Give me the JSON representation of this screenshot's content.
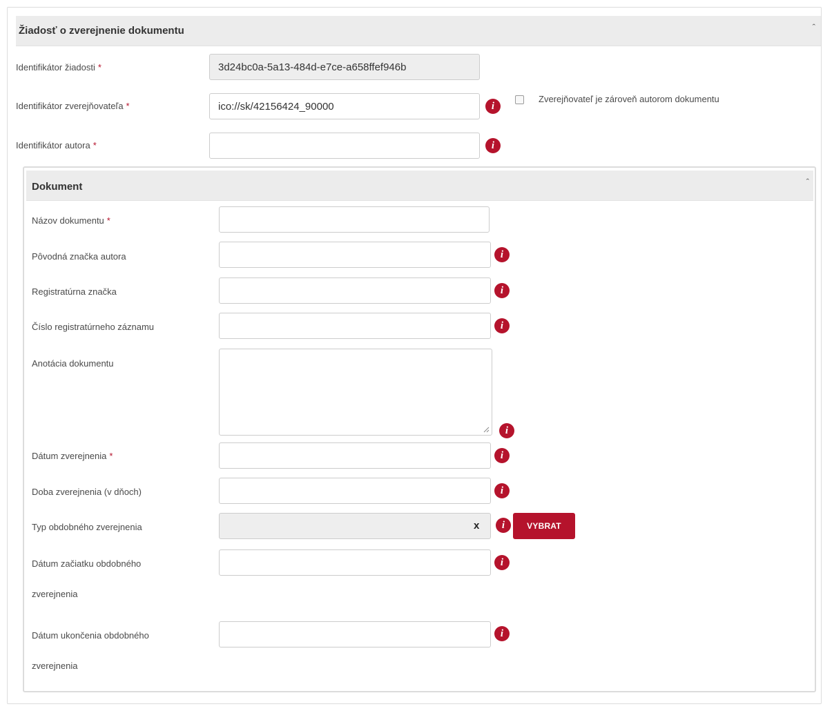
{
  "request_section": {
    "title": "Žiadosť o zverejnenie dokumentu",
    "collapse_glyph": "ˆ",
    "fields": {
      "request_id": {
        "label": "Identifikátor žiadosti",
        "required_mark": "*",
        "value": "3d24bc0a-5a13-484d-e7ce-a658ffef946b"
      },
      "publisher_id": {
        "label": "Identifikátor zverejňovateľa",
        "required_mark": "*",
        "value": "ico://sk/42156424_90000"
      },
      "author_id": {
        "label": "Identifikátor autora",
        "required_mark": "*",
        "value": ""
      }
    },
    "publisher_is_author_checkbox": {
      "label": "Zverejňovateľ je zároveň autorom dokumentu",
      "checked": false
    }
  },
  "document_section": {
    "title": "Dokument",
    "collapse_glyph": "ˆ",
    "fields": {
      "doc_name": {
        "label": "Názov dokumentu",
        "required_mark": "*",
        "value": ""
      },
      "orig_author_mark": {
        "label": "Pôvodná značka autora",
        "value": ""
      },
      "registry_mark": {
        "label": "Registratúrna značka",
        "value": ""
      },
      "registry_record_no": {
        "label": "Číslo registratúrneho záznamu",
        "value": ""
      },
      "annotation": {
        "label": "Anotácia dokumentu",
        "value": ""
      },
      "publish_date": {
        "label": "Dátum zverejnenia",
        "required_mark": "*",
        "value": ""
      },
      "publish_duration": {
        "label": "Doba zverejnenia (v dňoch)",
        "value": ""
      },
      "period_type": {
        "label": "Typ obdobného zverejnenia",
        "value": "",
        "clear_label": "x",
        "select_button_label": "VYBRAT"
      },
      "period_start": {
        "label_line1": "Dátum začiatku obdobného",
        "label_line2": "zverejnenia",
        "value": ""
      },
      "period_end": {
        "label_line1": "Dátum ukončenia obdobného",
        "label_line2": "zverejnenia",
        "value": ""
      }
    }
  },
  "info_icon_glyph": "i",
  "colors": {
    "accent": "#b5132c",
    "header_bg": "#ececec",
    "readonly_bg": "#eeeeee",
    "border": "#cccccc"
  }
}
